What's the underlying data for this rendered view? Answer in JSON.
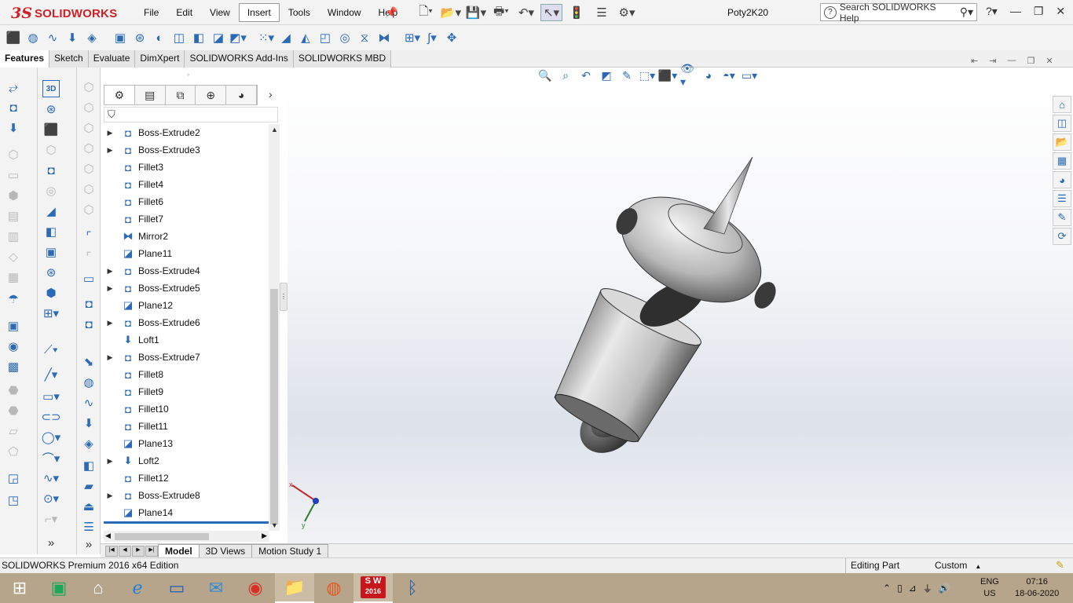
{
  "app": {
    "brand_ds": "3S",
    "brand_name": "SOLIDWORKS",
    "document_title": "Poty2K20"
  },
  "menu": [
    "File",
    "Edit",
    "View",
    "Insert",
    "Tools",
    "Window",
    "Help"
  ],
  "menu_active": "Insert",
  "search": {
    "placeholder": "Search SOLIDWORKS Help"
  },
  "command_tabs": [
    "Features",
    "Sketch",
    "Evaluate",
    "DimXpert",
    "SOLIDWORKS Add-Ins",
    "SOLIDWORKS MBD"
  ],
  "feature_tree": [
    {
      "label": "Boss-Extrude2",
      "expandable": true,
      "icon": "extrude-icon"
    },
    {
      "label": "Boss-Extrude3",
      "expandable": true,
      "icon": "extrude-icon"
    },
    {
      "label": "Fillet3",
      "expandable": false,
      "icon": "fillet-icon"
    },
    {
      "label": "Fillet4",
      "expandable": false,
      "icon": "fillet-icon"
    },
    {
      "label": "Fillet6",
      "expandable": false,
      "icon": "fillet-icon"
    },
    {
      "label": "Fillet7",
      "expandable": false,
      "icon": "fillet-icon"
    },
    {
      "label": "Mirror2",
      "expandable": false,
      "icon": "mirror-icon"
    },
    {
      "label": "Plane11",
      "expandable": false,
      "icon": "plane-icon"
    },
    {
      "label": "Boss-Extrude4",
      "expandable": true,
      "icon": "extrude-icon"
    },
    {
      "label": "Boss-Extrude5",
      "expandable": true,
      "icon": "extrude-icon"
    },
    {
      "label": "Plane12",
      "expandable": false,
      "icon": "plane-icon"
    },
    {
      "label": "Boss-Extrude6",
      "expandable": true,
      "icon": "extrude-icon"
    },
    {
      "label": "Loft1",
      "expandable": false,
      "icon": "loft-icon"
    },
    {
      "label": "Boss-Extrude7",
      "expandable": true,
      "icon": "extrude-icon"
    },
    {
      "label": "Fillet8",
      "expandable": false,
      "icon": "fillet-icon"
    },
    {
      "label": "Fillet9",
      "expandable": false,
      "icon": "fillet-icon"
    },
    {
      "label": "Fillet10",
      "expandable": false,
      "icon": "fillet-icon"
    },
    {
      "label": "Fillet11",
      "expandable": false,
      "icon": "fillet-icon"
    },
    {
      "label": "Plane13",
      "expandable": false,
      "icon": "plane-icon"
    },
    {
      "label": "Loft2",
      "expandable": true,
      "icon": "loft-icon"
    },
    {
      "label": "Fillet12",
      "expandable": false,
      "icon": "fillet-icon"
    },
    {
      "label": "Boss-Extrude8",
      "expandable": true,
      "icon": "extrude-icon"
    },
    {
      "label": "Plane14",
      "expandable": false,
      "icon": "plane-icon"
    }
  ],
  "bottom_tabs": [
    "Model",
    "3D Views",
    "Motion Study 1"
  ],
  "bottom_tab_active": "Model",
  "status": {
    "edition": "SOLIDWORKS Premium 2016 x64 Edition",
    "mode": "Editing Part",
    "units": "Custom"
  },
  "taskbar": {
    "sw_badge": "2016",
    "lang": "ENG",
    "region": "US",
    "time": "07:16",
    "date": "18-06-2020"
  },
  "colors": {
    "brand": "#d22027",
    "accent": "#2a6ab8",
    "taskbar": "#b6a48b"
  }
}
